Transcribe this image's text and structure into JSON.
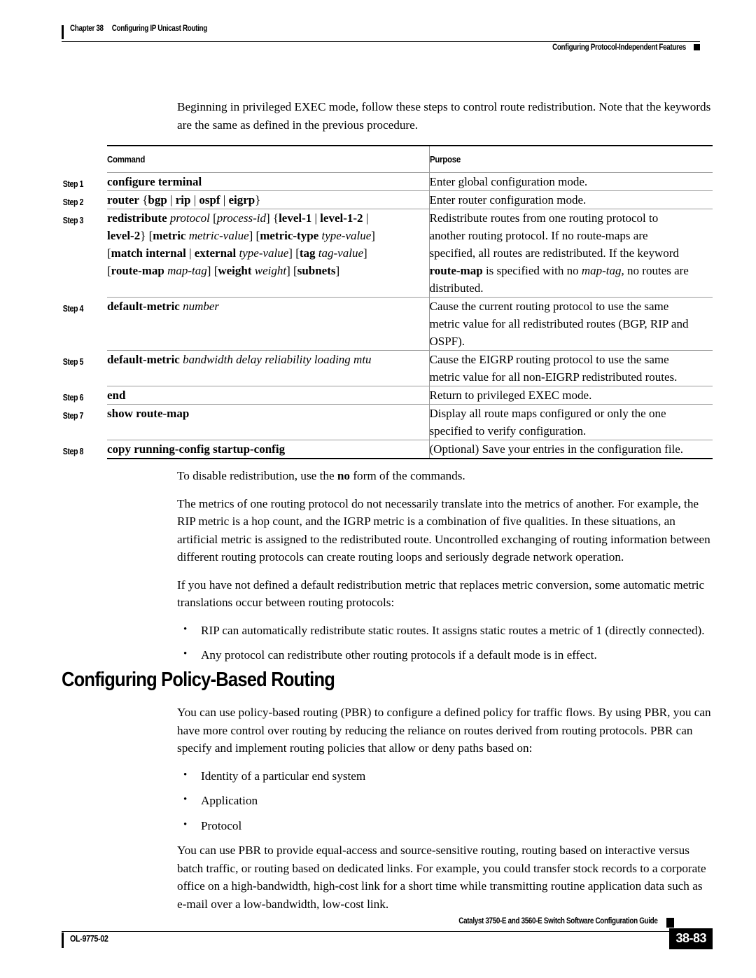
{
  "running_head": {
    "chapter": "Chapter 38",
    "chapter_title": "Configuring IP Unicast Routing",
    "section": "Configuring Protocol-Independent Features"
  },
  "intro": {
    "paragraph": "Beginning in privileged EXEC mode, follow these steps to control route redistribution. Note that the keywords are the same as defined in the previous procedure."
  },
  "table": {
    "headers": {
      "command": "Command",
      "purpose": "Purpose"
    },
    "rows": [
      {
        "step": "Step 1",
        "command_plain": "configure terminal",
        "purpose_plain": "Enter global configuration mode."
      },
      {
        "step": "Step 2",
        "command_plain": "router {bgp | rip | ospf | eigrp}",
        "purpose_plain": "Enter router configuration mode."
      },
      {
        "step": "Step 3",
        "command_plain": "redistribute protocol [process-id] {level-1 | level-1-2 | level-2} [metric metric-value] [metric-type type-value] [match internal | external type-value] [tag tag-value] [route-map map-tag] [weight weight] [subnets]",
        "purpose_plain": "Redistribute routes from one routing protocol to another routing protocol. If no route-maps are specified, all routes are redistributed. If the keyword route-map is specified with no map-tag, no routes are distributed."
      },
      {
        "step": "Step 4",
        "command_plain": "default-metric number",
        "purpose_plain": "Cause the current routing protocol to use the same metric value for all redistributed routes (BGP, RIP and OSPF)."
      },
      {
        "step": "Step 5",
        "command_plain": "default-metric bandwidth delay reliability loading mtu",
        "purpose_plain": "Cause the EIGRP routing protocol to use the same metric value for all non-EIGRP redistributed routes."
      },
      {
        "step": "Step 6",
        "command_plain": "end",
        "purpose_plain": "Return to privileged EXEC mode."
      },
      {
        "step": "Step 7",
        "command_plain": "show route-map",
        "purpose_plain": "Display all route maps configured or only the one specified to verify configuration."
      },
      {
        "step": "Step 8",
        "command_plain": "copy running-config startup-config",
        "purpose_plain": "(Optional) Save your entries in the configuration file."
      }
    ]
  },
  "after_table": {
    "p1": "To disable redistribution, use the no form of the commands.",
    "p2": "The metrics of one routing protocol do not necessarily translate into the metrics of another. For example, the RIP metric is a hop count, and the IGRP metric is a combination of five qualities. In these situations, an artificial metric is assigned to the redistributed route. Uncontrolled exchanging of routing information between different routing protocols can create routing loops and seriously degrade network operation.",
    "p3": "If you have not defined a default redistribution metric that replaces metric conversion, some automatic metric translations occur between routing protocols:",
    "bullets": [
      "RIP can automatically redistribute static routes. It assigns static routes a metric of 1 (directly connected).",
      "Any protocol can redistribute other routing protocols if a default mode is in effect."
    ]
  },
  "section_heading": "Configuring Policy-Based Routing",
  "pbr": {
    "p1": "You can use policy-based routing (PBR) to configure a defined policy for traffic flows. By using PBR, you can have more control over routing by reducing the reliance on routes derived from routing protocols. PBR can specify and implement routing policies that allow or deny paths based on:",
    "bullets": [
      "Identity of a particular end system",
      "Application",
      "Protocol"
    ],
    "p2": "You can use PBR to provide equal-access and source-sensitive routing, routing based on interactive versus batch traffic, or routing based on dedicated links. For example, you could transfer stock records to a corporate office on a high-bandwidth, high-cost link for a short time while transmitting routine application data such as e-mail over a low-bandwidth, low-cost link."
  },
  "footer": {
    "guide_title": "Catalyst 3750-E and 3560-E Switch Software Configuration Guide",
    "doc_id": "OL-9775-02",
    "page_number": "38-83"
  },
  "bullet_glyph": "•"
}
